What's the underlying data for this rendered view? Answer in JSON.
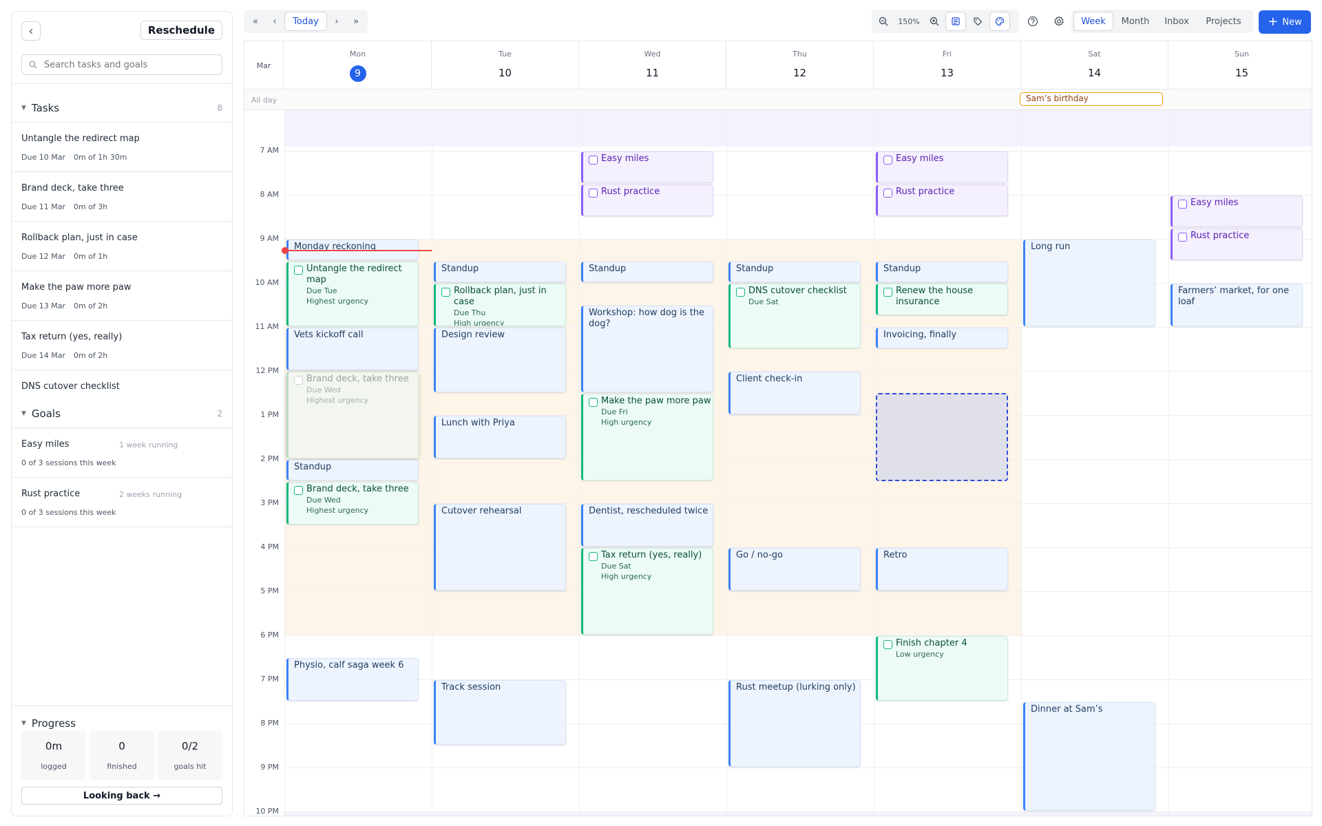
{
  "sidebar": {
    "reschedule_label": "Reschedule",
    "search_placeholder": "Search tasks and goals",
    "tasks_title": "Tasks",
    "tasks_count": "8",
    "tasks": [
      {
        "name": "Untangle the redirect map",
        "due": "Due 10 Mar",
        "progress": "0m of 1h 30m"
      },
      {
        "name": "Brand deck, take three",
        "due": "Due 11 Mar",
        "progress": "0m of 3h"
      },
      {
        "name": "Rollback plan, just in case",
        "due": "Due 12 Mar",
        "progress": "0m of 1h"
      },
      {
        "name": "Make the paw more paw",
        "due": "Due 13 Mar",
        "progress": "0m of 2h"
      },
      {
        "name": "Tax return (yes, really)",
        "due": "Due 14 Mar",
        "progress": "0m of 2h"
      },
      {
        "name": "DNS cutover checklist",
        "due": "",
        "progress": ""
      }
    ],
    "goals_title": "Goals",
    "goals_count": "2",
    "goals": [
      {
        "name": "Easy miles",
        "running": "1 week running",
        "sessions": "0 of 3 sessions this week"
      },
      {
        "name": "Rust practice",
        "running": "2 weeks running",
        "sessions": "0 of 3 sessions this week"
      }
    ],
    "progress_title": "Progress",
    "stats": [
      {
        "value": "0m",
        "label": "logged"
      },
      {
        "value": "0",
        "label": "finished"
      },
      {
        "value": "0/2",
        "label": "goals hit"
      }
    ],
    "looking_back": "Looking back →"
  },
  "toolbar": {
    "today": "Today",
    "zoom": "150%",
    "views": [
      "Week",
      "Month",
      "Inbox",
      "Projects"
    ],
    "active_view": "Week",
    "new_label": "New",
    "accent": "#2563eb"
  },
  "calendar": {
    "month": "Mar",
    "allday_label": "All day",
    "days": [
      {
        "name": "Mon",
        "date": "9",
        "today": true
      },
      {
        "name": "Tue",
        "date": "10"
      },
      {
        "name": "Wed",
        "date": "11"
      },
      {
        "name": "Thu",
        "date": "12"
      },
      {
        "name": "Fri",
        "date": "13"
      },
      {
        "name": "Sat",
        "date": "14"
      },
      {
        "name": "Sun",
        "date": "15"
      }
    ],
    "allday_event": "Sam’s birthday",
    "hours": [
      "7 AM",
      "8 AM",
      "9 AM",
      "10 AM",
      "11 AM",
      "12 PM",
      "1 PM",
      "2 PM",
      "3 PM",
      "4 PM",
      "5 PM",
      "6 PM",
      "7 PM",
      "8 PM",
      "9 PM",
      "10 PM"
    ],
    "events": [
      {
        "day": 0,
        "start": "9:00",
        "end": "9:30",
        "title": "Monday reckoning",
        "kind": "blue"
      },
      {
        "day": 0,
        "start": "9:30",
        "end": "11:00",
        "title": "Untangle the redirect map",
        "kind": "green",
        "sub": [
          "Due Tue",
          "Highest urgency"
        ]
      },
      {
        "day": 0,
        "start": "11:00",
        "end": "12:00",
        "title": "Vets kickoff call",
        "kind": "blue"
      },
      {
        "day": 0,
        "start": "12:00",
        "end": "14:00",
        "title": "Brand deck, take three",
        "kind": "ghost",
        "sub": [
          "Due Wed",
          "Highest urgency"
        ]
      },
      {
        "day": 0,
        "start": "14:00",
        "end": "14:30",
        "title": "Standup",
        "kind": "blue"
      },
      {
        "day": 0,
        "start": "14:30",
        "end": "15:30",
        "title": "Brand deck, take three",
        "kind": "green",
        "sub": [
          "Due Wed",
          "Highest urgency"
        ]
      },
      {
        "day": 0,
        "start": "18:30",
        "end": "19:30",
        "title": "Physio, calf saga week 6",
        "kind": "blue"
      },
      {
        "day": 1,
        "start": "9:30",
        "end": "10:00",
        "title": "Standup",
        "kind": "blue"
      },
      {
        "day": 1,
        "start": "10:00",
        "end": "11:00",
        "title": "Rollback plan, just in case",
        "kind": "green",
        "sub": [
          "Due Thu",
          "High urgency"
        ]
      },
      {
        "day": 1,
        "start": "11:00",
        "end": "12:30",
        "title": "Design review",
        "kind": "blue"
      },
      {
        "day": 1,
        "start": "13:00",
        "end": "14:00",
        "title": "Lunch with Priya",
        "kind": "blue"
      },
      {
        "day": 1,
        "start": "15:00",
        "end": "17:00",
        "title": "Cutover rehearsal",
        "kind": "blue"
      },
      {
        "day": 1,
        "start": "19:00",
        "end": "20:30",
        "title": "Track session",
        "kind": "blue"
      },
      {
        "day": 2,
        "start": "7:00",
        "end": "7:45",
        "title": "Easy miles",
        "kind": "purple"
      },
      {
        "day": 2,
        "start": "7:45",
        "end": "8:30",
        "title": "Rust practice",
        "kind": "purple"
      },
      {
        "day": 2,
        "start": "9:30",
        "end": "10:00",
        "title": "Standup",
        "kind": "blue"
      },
      {
        "day": 2,
        "start": "10:30",
        "end": "12:30",
        "title": "Workshop: how dog is the dog?",
        "kind": "blue"
      },
      {
        "day": 2,
        "start": "12:30",
        "end": "14:30",
        "title": "Make the paw more paw",
        "kind": "green",
        "sub": [
          "Due Fri",
          "High urgency"
        ]
      },
      {
        "day": 2,
        "start": "15:00",
        "end": "16:00",
        "title": "Dentist, rescheduled twice",
        "kind": "blue"
      },
      {
        "day": 2,
        "start": "16:00",
        "end": "18:00",
        "title": "Tax return (yes, really)",
        "kind": "green",
        "sub": [
          "Due Sat",
          "High urgency"
        ]
      },
      {
        "day": 3,
        "start": "9:30",
        "end": "10:00",
        "title": "Standup",
        "kind": "blue"
      },
      {
        "day": 3,
        "start": "10:00",
        "end": "11:30",
        "title": "DNS cutover checklist",
        "kind": "green",
        "sub": [
          "Due Sat"
        ]
      },
      {
        "day": 3,
        "start": "12:00",
        "end": "13:00",
        "title": "Client check-in",
        "kind": "blue"
      },
      {
        "day": 3,
        "start": "16:00",
        "end": "17:00",
        "title": "Go / no-go",
        "kind": "blue"
      },
      {
        "day": 3,
        "start": "19:00",
        "end": "21:00",
        "title": "Rust meetup (lurking only)",
        "kind": "blue"
      },
      {
        "day": 4,
        "start": "7:00",
        "end": "7:45",
        "title": "Easy miles",
        "kind": "purple"
      },
      {
        "day": 4,
        "start": "7:45",
        "end": "8:30",
        "title": "Rust practice",
        "kind": "purple"
      },
      {
        "day": 4,
        "start": "9:30",
        "end": "10:00",
        "title": "Standup",
        "kind": "blue"
      },
      {
        "day": 4,
        "start": "10:00",
        "end": "10:45",
        "title": "Renew the house insurance",
        "kind": "green"
      },
      {
        "day": 4,
        "start": "11:00",
        "end": "11:30",
        "title": "Invoicing, finally",
        "kind": "blue"
      },
      {
        "day": 4,
        "start": "16:00",
        "end": "17:00",
        "title": "Retro",
        "kind": "blue"
      },
      {
        "day": 4,
        "start": "18:00",
        "end": "19:30",
        "title": "Finish chapter 4",
        "kind": "green",
        "sub": [
          "Low urgency"
        ]
      },
      {
        "day": 5,
        "start": "9:00",
        "end": "11:00",
        "title": "Long run",
        "kind": "blue"
      },
      {
        "day": 5,
        "start": "19:30",
        "end": "22:00",
        "title": "Dinner at Sam’s",
        "kind": "blue"
      },
      {
        "day": 6,
        "start": "8:00",
        "end": "8:45",
        "title": "Easy miles",
        "kind": "purple"
      },
      {
        "day": 6,
        "start": "8:45",
        "end": "9:30",
        "title": "Rust practice",
        "kind": "purple"
      },
      {
        "day": 6,
        "start": "10:00",
        "end": "11:00",
        "title": "Farmers’ market, for one loaf",
        "kind": "blue"
      }
    ],
    "now_time": "9:15",
    "selection": {
      "day": 4,
      "start": "12:30",
      "end": "14:30"
    }
  }
}
